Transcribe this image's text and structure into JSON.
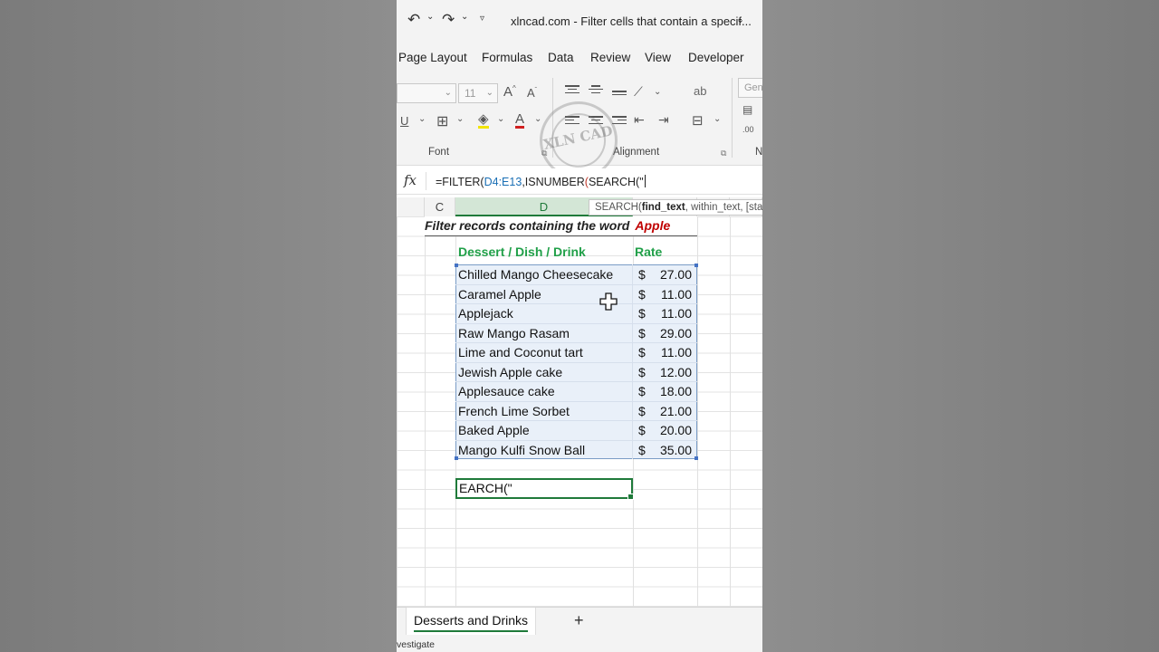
{
  "titlebar": {
    "doc_title": "xlncad.com - Filter cells that contain a specif...",
    "undo_icon": "undo-icon",
    "redo_icon": "redo-icon",
    "customize_icon": "customize-qat-icon"
  },
  "ribbon_tabs": [
    "Page Layout",
    "Formulas",
    "Data",
    "Review",
    "View",
    "Developer"
  ],
  "ribbon": {
    "font_size": "11",
    "number_format": "Gene",
    "font_group": "Font",
    "alignment_group": "Alignment",
    "number_group_partial": "N",
    "underline": "U",
    "indicator": ".00"
  },
  "watermark": {
    "text": "XLN CAD"
  },
  "formula_bar": {
    "fx": "fx",
    "text_prefix": "=FILTER(",
    "ref": "D4:E13",
    "text_mid": ",ISNUMBER",
    "paren": "(",
    "text_end": "SEARCH(\""
  },
  "columns": {
    "c": "C",
    "d": "D"
  },
  "tooltip": {
    "func": "SEARCH(",
    "arg1": "find_text",
    "rest": ", within_text, [sta"
  },
  "sheet": {
    "heading": "Filter records containing the word",
    "keyword": "Apple",
    "col1_header": "Dessert / Dish / Drink",
    "col2_header": "Rate",
    "currency": "$",
    "rows": [
      {
        "name": "Chilled Mango Cheesecake",
        "rate": "27.00"
      },
      {
        "name": "Caramel Apple",
        "rate": "11.00"
      },
      {
        "name": "Applejack",
        "rate": "11.00"
      },
      {
        "name": "Raw Mango Rasam",
        "rate": "29.00"
      },
      {
        "name": "Lime and Coconut tart",
        "rate": "11.00"
      },
      {
        "name": "Jewish Apple cake",
        "rate": "12.00"
      },
      {
        "name": "Applesauce cake",
        "rate": "18.00"
      },
      {
        "name": "French Lime Sorbet",
        "rate": "21.00"
      },
      {
        "name": "Baked Apple",
        "rate": "20.00"
      },
      {
        "name": "Mango Kulfi Snow Ball",
        "rate": "35.00"
      }
    ],
    "active_cell_text": "EARCH(\""
  },
  "sheet_tabs": {
    "active": "Desserts and Drinks",
    "add": "+"
  },
  "status": {
    "text": "vestigate"
  },
  "colors": {
    "accent": "#1f7a3a",
    "header_green": "#21a049",
    "keyword_red": "#c00000",
    "selection": "#e9f0f9"
  }
}
